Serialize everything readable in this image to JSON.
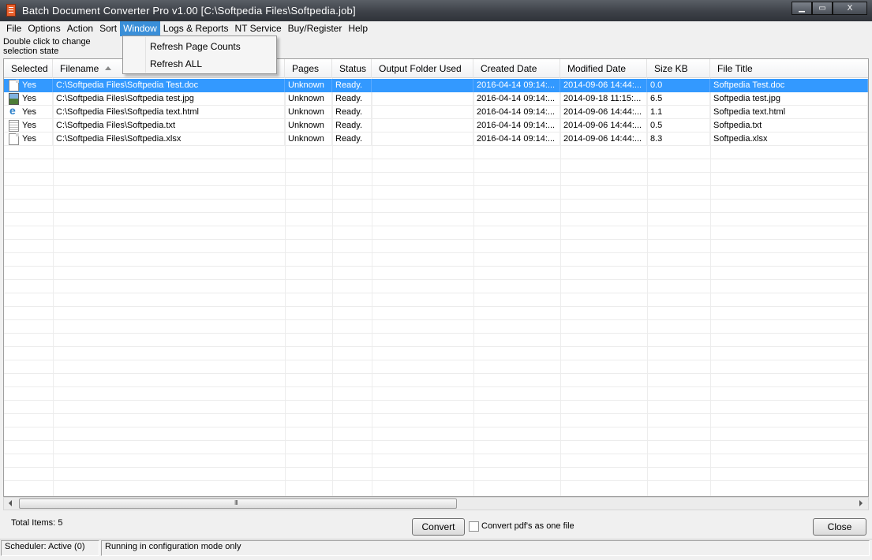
{
  "window": {
    "title": "Batch Document Converter Pro v1.00  [C:\\Softpedia Files\\Softpedia.job]",
    "controls": {
      "minimize": "▁",
      "maximize": "▭",
      "close": "X"
    }
  },
  "menu": [
    "File",
    "Options",
    "Action",
    "Sort",
    "Window",
    "Logs & Reports",
    "NT Service",
    "Buy/Register",
    "Help"
  ],
  "active_menu": "Window",
  "hint": "Double click to change selection state",
  "window_menu": {
    "items": [
      "Refresh Page Counts",
      "Refresh ALL"
    ]
  },
  "table": {
    "columns": [
      "Selected",
      "Filename",
      "Pages",
      "Status",
      "Output Folder Used",
      "Created Date",
      "Modified Date",
      "Size KB",
      "File Title"
    ],
    "sorted_column": "Filename",
    "rows": [
      {
        "icon": "document-icon",
        "selected": "Yes",
        "filename": "C:\\Softpedia Files\\Softpedia Test.doc",
        "pages": "Unknown",
        "status": "Ready.",
        "output": "",
        "created": "2016-04-14 09:14:...",
        "modified": "2014-09-06 14:44:...",
        "size": "0.0",
        "title": "Softpedia Test.doc"
      },
      {
        "icon": "image-icon",
        "selected": "Yes",
        "filename": "C:\\Softpedia Files\\Softpedia test.jpg",
        "pages": "Unknown",
        "status": "Ready.",
        "output": "",
        "created": "2016-04-14 09:14:...",
        "modified": "2014-09-18 11:15:...",
        "size": "6.5",
        "title": "Softpedia test.jpg"
      },
      {
        "icon": "html-icon",
        "selected": "Yes",
        "filename": "C:\\Softpedia Files\\Softpedia text.html",
        "pages": "Unknown",
        "status": "Ready.",
        "output": "",
        "created": "2016-04-14 09:14:...",
        "modified": "2014-09-06 14:44:...",
        "size": "1.1",
        "title": "Softpedia text.html"
      },
      {
        "icon": "text-file-icon",
        "selected": "Yes",
        "filename": "C:\\Softpedia Files\\Softpedia.txt",
        "pages": "Unknown",
        "status": "Ready.",
        "output": "",
        "created": "2016-04-14 09:14:...",
        "modified": "2014-09-06 14:44:...",
        "size": "0.5",
        "title": "Softpedia.txt"
      },
      {
        "icon": "document-icon",
        "selected": "Yes",
        "filename": "C:\\Softpedia Files\\Softpedia.xlsx",
        "pages": "Unknown",
        "status": "Ready.",
        "output": "",
        "created": "2016-04-14 09:14:...",
        "modified": "2014-09-06 14:44:...",
        "size": "8.3",
        "title": "Softpedia.xlsx"
      }
    ]
  },
  "scrollbar": {
    "grip": "III"
  },
  "footer": {
    "total_label": "Total Items:",
    "total_value": "5",
    "convert_label": "Convert",
    "checkbox_label": "Convert pdf's as one file",
    "close_label": "Close"
  },
  "statusbar": {
    "scheduler": "Scheduler: Active (0)",
    "message": "Running in configuration mode only"
  },
  "colors": {
    "selection": "#3399ff",
    "menu_highlight": "#3a8fd8",
    "titlebar": "#3d4148"
  }
}
